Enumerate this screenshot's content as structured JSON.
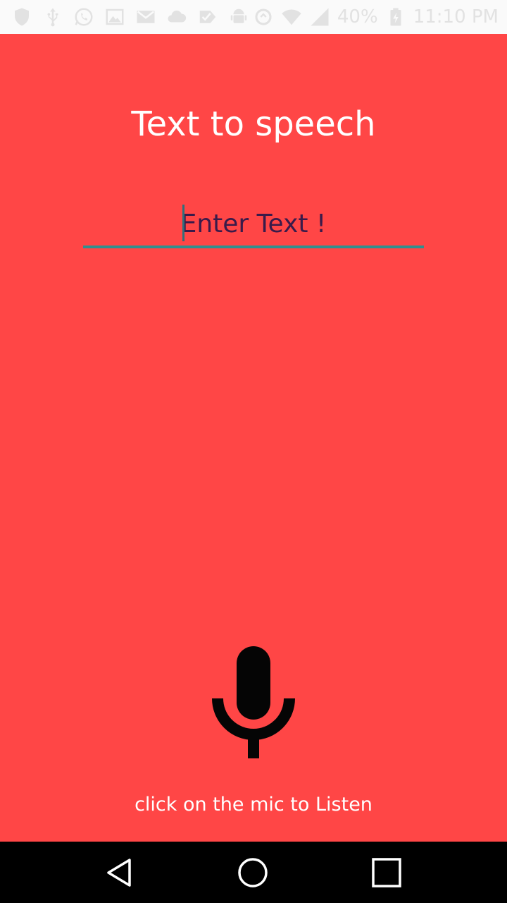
{
  "status_bar": {
    "left_icons": [
      "shield-icon",
      "usb-icon",
      "whatsapp-icon",
      "image-icon",
      "gmail-icon",
      "cloud-icon",
      "check-flag-icon",
      "android-icon"
    ],
    "right_icons": [
      "sync-icon",
      "wifi-icon",
      "signal-icon"
    ],
    "battery_percent": "40%",
    "battery_icon": "battery-charging-icon",
    "time": "11:10 PM"
  },
  "app": {
    "title": "Text to speech",
    "input_placeholder": "Enter Text !",
    "input_value": "",
    "mic_icon": "microphone-icon",
    "hint": "click on the mic to Listen"
  },
  "nav_bar": {
    "back_icon": "back-triangle-icon",
    "home_icon": "home-circle-icon",
    "recent_icon": "recent-apps-square-icon"
  },
  "colors": {
    "background": "#ff4646",
    "status_bar": "#fafafa",
    "status_icons": "#e2e2e2",
    "input_underline": "#2f8f8f",
    "input_text": "#3a1b4a",
    "nav_bar": "#000000"
  }
}
